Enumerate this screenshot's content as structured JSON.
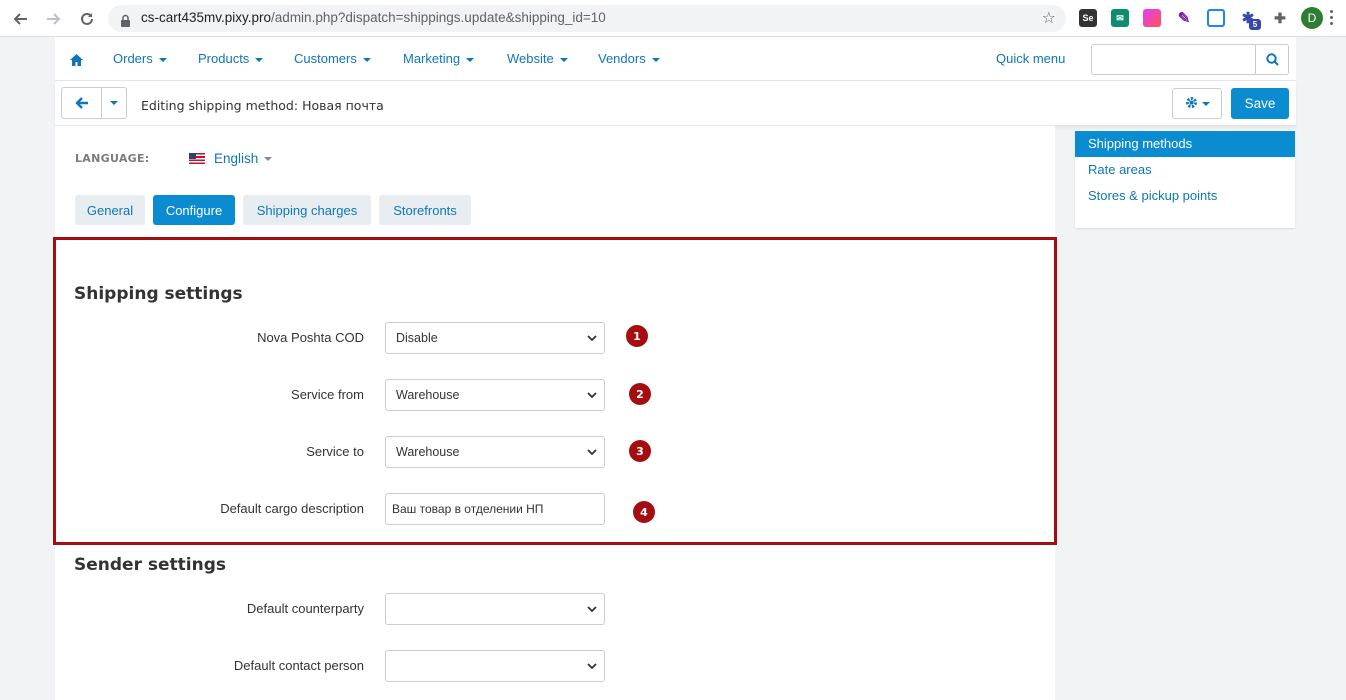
{
  "browser": {
    "url_host": "cs-cart435mv.pixy.pro",
    "url_path": "/admin.php?dispatch=shippings.update&shipping_id=10",
    "profile_initial": "D",
    "extension_badge": "5"
  },
  "nav": {
    "items": [
      "Orders",
      "Products",
      "Customers",
      "Marketing",
      "Website",
      "Vendors"
    ],
    "quick_menu": "Quick menu",
    "search_placeholder": ""
  },
  "toolbar": {
    "title_prefix": "Editing shipping method:",
    "title_name": "Новая почта",
    "save_label": "Save"
  },
  "language": {
    "label": "LANGUAGE:",
    "value": "English"
  },
  "tabs": [
    "General",
    "Configure",
    "Shipping charges",
    "Storefronts"
  ],
  "active_tab": "Configure",
  "shipping_settings": {
    "title": "Shipping settings",
    "fields": [
      {
        "label": "Nova Poshta COD",
        "value": "Disable",
        "badge": "1"
      },
      {
        "label": "Service from",
        "value": "Warehouse",
        "badge": "2"
      },
      {
        "label": "Service to",
        "value": "Warehouse",
        "badge": "3"
      },
      {
        "label": "Default cargo description",
        "value": "Ваш товар в отделении НП",
        "badge": "4"
      }
    ]
  },
  "sender_settings": {
    "title": "Sender settings",
    "fields": [
      {
        "label": "Default counterparty",
        "value": ""
      },
      {
        "label": "Default contact person",
        "value": ""
      }
    ]
  },
  "sidebar": {
    "items": [
      "Shipping methods",
      "Rate areas",
      "Stores & pickup points"
    ]
  },
  "colors": {
    "accent": "#0b8bd0",
    "link": "#0f76b9",
    "highlight_border": "#a50e10"
  }
}
